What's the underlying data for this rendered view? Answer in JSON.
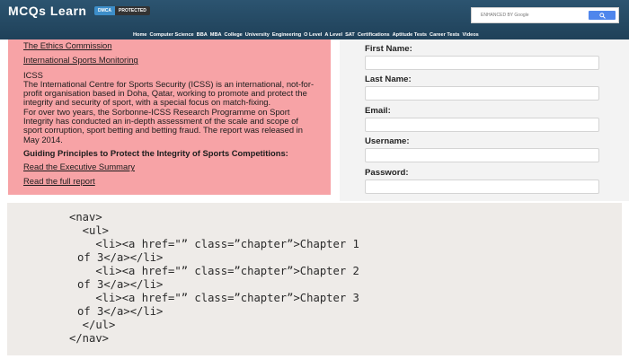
{
  "header": {
    "logo": "MCQs Learn",
    "dmca_badge": {
      "left": "DMCA",
      "right": "PROTECTED"
    },
    "search": {
      "placeholder": "ENHANCED BY Google",
      "button_icon": "search-icon"
    },
    "nav": [
      "Home",
      "Computer Science",
      "BBA",
      "MBA",
      "College",
      "University",
      "Engineering",
      "O Level",
      "A Level",
      "SAT",
      "Certifications",
      "Aptitude Tests",
      "Career Tests",
      "Videos"
    ]
  },
  "article": {
    "link1": "The Ethics Commission",
    "link2": "International Sports Monitoring",
    "icss_heading": "ICSS",
    "paragraph1": "The International Centre for Sports Security (ICSS) is an international, not-for-profit organisation based in Doha, Qatar, working to promote and protect the integrity and security of sport, with a special focus on match-fixing.",
    "paragraph2": "For over two years, the Sorbonne-ICSS Research Programme on Sport Integrity has conducted an in-depth assessment of the scale and scope of sport corruption, sport betting and betting fraud. The report was released in May 2014.",
    "guiding_title": "Guiding Principles to Protect the Integrity of Sports Competitions:",
    "link3": "Read the Executive Summary",
    "link4": "Read the full report"
  },
  "form": {
    "first_name": "First Name:",
    "last_name": "Last Name:",
    "email": "Email:",
    "username": "Username:",
    "password": "Password:"
  },
  "code": [
    "<nav>",
    "  <ul>",
    "    <li><a href=\"” class=”chapter”>Chapter 1",
    "of 3</a></li>",
    "    <li><a href=\"” class=”chapter”>Chapter 2",
    "of 3</a></li>",
    "    <li><a href=\"” class=”chapter”>Chapter 3",
    "of 3</a></li>",
    "  </ul>",
    "</nav>"
  ],
  "colors": {
    "header_bg": "#2c5470",
    "pink_card": "#f7a3a6",
    "form_bg": "#f3f3f3",
    "code_bg": "#eeebe8",
    "search_button": "#4f86ec"
  }
}
